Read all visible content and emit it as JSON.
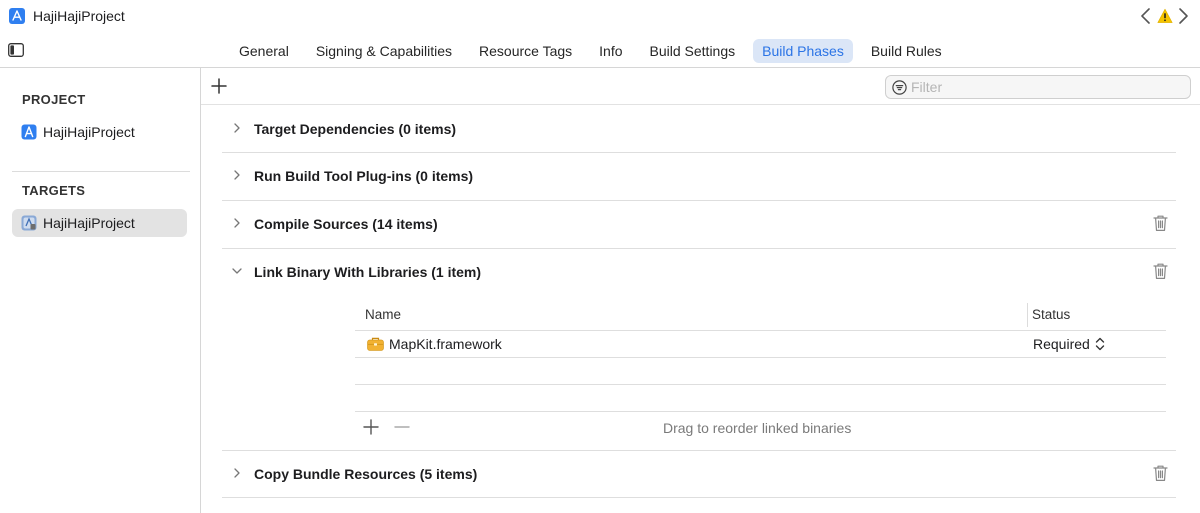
{
  "window": {
    "title": "HajiHajiProject"
  },
  "tabs": [
    {
      "label": "General"
    },
    {
      "label": "Signing & Capabilities"
    },
    {
      "label": "Resource Tags"
    },
    {
      "label": "Info"
    },
    {
      "label": "Build Settings"
    },
    {
      "label": "Build Phases",
      "active": true
    },
    {
      "label": "Build Rules"
    }
  ],
  "sidebar": {
    "project_heading": "PROJECT",
    "project_item": "HajiHajiProject",
    "targets_heading": "TARGETS",
    "target_item": "HajiHajiProject"
  },
  "filter": {
    "placeholder": "Filter"
  },
  "phases": [
    {
      "title": "Target Dependencies (0 items)",
      "expanded": false
    },
    {
      "title": "Run Build Tool Plug-ins (0 items)",
      "expanded": false
    },
    {
      "title": "Compile Sources (14 items)",
      "expanded": false
    },
    {
      "title": "Link Binary With Libraries (1 item)",
      "expanded": true
    },
    {
      "title": "Copy Bundle Resources (5 items)",
      "expanded": false
    }
  ],
  "libraries": {
    "col_name": "Name",
    "col_status": "Status",
    "rows": [
      {
        "name": "MapKit.framework",
        "status": "Required"
      }
    ],
    "drag_hint": "Drag to reorder linked binaries"
  },
  "colors": {
    "accent": "#2b74e6",
    "tab_active_bg": "#dbe6f7",
    "selected_bg": "#e3e3e3",
    "warning": "#f5c400",
    "framework_icon": "#f2b233"
  },
  "icons": [
    "app-icon",
    "chevron-left-icon",
    "warning-icon",
    "chevron-right-icon",
    "sidebar-toggle-icon",
    "plus-icon",
    "filter-icon",
    "disclosure-chevron-icon",
    "trash-icon",
    "framework-icon",
    "stepper-icon",
    "minus-icon"
  ]
}
